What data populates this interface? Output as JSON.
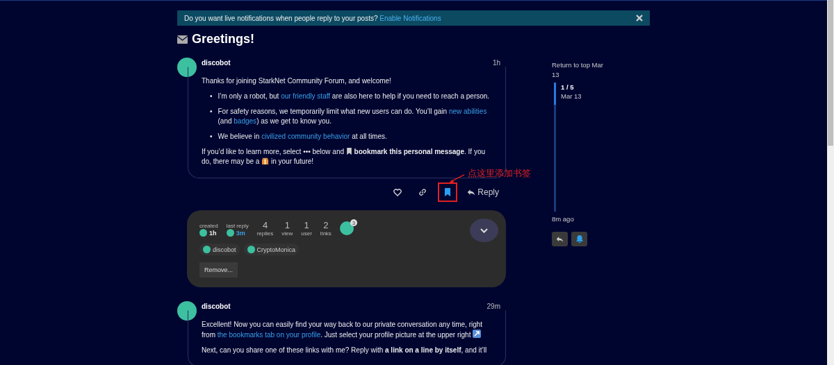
{
  "banner": {
    "text": "Do you want live notifications when people reply to your posts?",
    "link": "Enable Notifications"
  },
  "topic": {
    "title": "Greetings!"
  },
  "posts": [
    {
      "author": "discobot",
      "time": "1h",
      "paragraphs": [
        {
          "kind": "para",
          "segments": [
            {
              "kind": "text",
              "text": "Thanks for joining StarkNet Community Forum, and welcome!"
            }
          ]
        },
        {
          "kind": "bullet",
          "marker": "•",
          "segments": [
            {
              "kind": "text",
              "text": "I’m only a robot, but "
            },
            {
              "kind": "link",
              "text": "our friendly staff"
            },
            {
              "kind": "text",
              "text": " are also here to help if you need to reach a person."
            }
          ]
        },
        {
          "kind": "bullet",
          "marker": "•",
          "segments": [
            {
              "kind": "text",
              "text": "For safety reasons, we temporarily limit what new users can do. You’ll gain "
            },
            {
              "kind": "link",
              "text": "new abilities"
            },
            {
              "kind": "text",
              "text": " (and "
            },
            {
              "kind": "link",
              "text": "badges"
            },
            {
              "kind": "text",
              "text": ") as we get to know you."
            }
          ]
        },
        {
          "kind": "bullet",
          "marker": "•",
          "segments": [
            {
              "kind": "text",
              "text": "We believe in "
            },
            {
              "kind": "link",
              "text": "civilized community behavior"
            },
            {
              "kind": "text",
              "text": " at all times."
            }
          ]
        },
        {
          "kind": "para",
          "segments": [
            {
              "kind": "text",
              "text": "If you’d like to learn more, select ••• below and "
            },
            {
              "kind": "bookmark"
            },
            {
              "kind": "bold",
              "text": " bookmark this personal message"
            },
            {
              "kind": "text",
              "text": ". If you do, there may be a "
            },
            {
              "kind": "gift"
            },
            {
              "kind": "text",
              "text": " in your future!"
            }
          ]
        }
      ],
      "actions": {
        "reply": "Reply",
        "bookmarked": true,
        "highlighted": true
      }
    },
    {
      "author": "discobot",
      "time": "29m",
      "paragraphs": [
        {
          "kind": "para",
          "segments": [
            {
              "kind": "text",
              "text": "Excellent! Now you can easily find your way back to our private conversation any time, right from "
            },
            {
              "kind": "link",
              "text": "the bookmarks tab on your profile"
            },
            {
              "kind": "text",
              "text": ". Just select your profile picture at the upper right "
            },
            {
              "kind": "arrow"
            }
          ]
        },
        {
          "kind": "para",
          "segments": [
            {
              "kind": "text",
              "text": "Next, can you share one of these links with me? Reply with "
            },
            {
              "kind": "bold",
              "text": "a link on a line by itself"
            },
            {
              "kind": "text",
              "text": ", and it’ll"
            }
          ]
        }
      ]
    }
  ],
  "annotation": {
    "text": "点这里添加书签"
  },
  "topic_map": {
    "stats": [
      {
        "kind": "created",
        "label": "created",
        "value": "1h"
      },
      {
        "kind": "last_reply",
        "label": "last reply",
        "value": "3m"
      },
      {
        "kind": "count",
        "value": "4",
        "label": "replies"
      },
      {
        "kind": "count",
        "value": "1",
        "label": "view"
      },
      {
        "kind": "count",
        "value": "1",
        "label": "user"
      },
      {
        "kind": "count",
        "value": "2",
        "label": "links"
      },
      {
        "kind": "avatar",
        "value": "3"
      }
    ],
    "participants": [
      "discobot",
      "CryptoMonica"
    ],
    "remove": "Remove..."
  },
  "timeline": {
    "top": "Return to top Mar 13",
    "position": "1 / 5",
    "date": "Mar 13",
    "ago": "8m ago",
    "level": 0.17
  }
}
